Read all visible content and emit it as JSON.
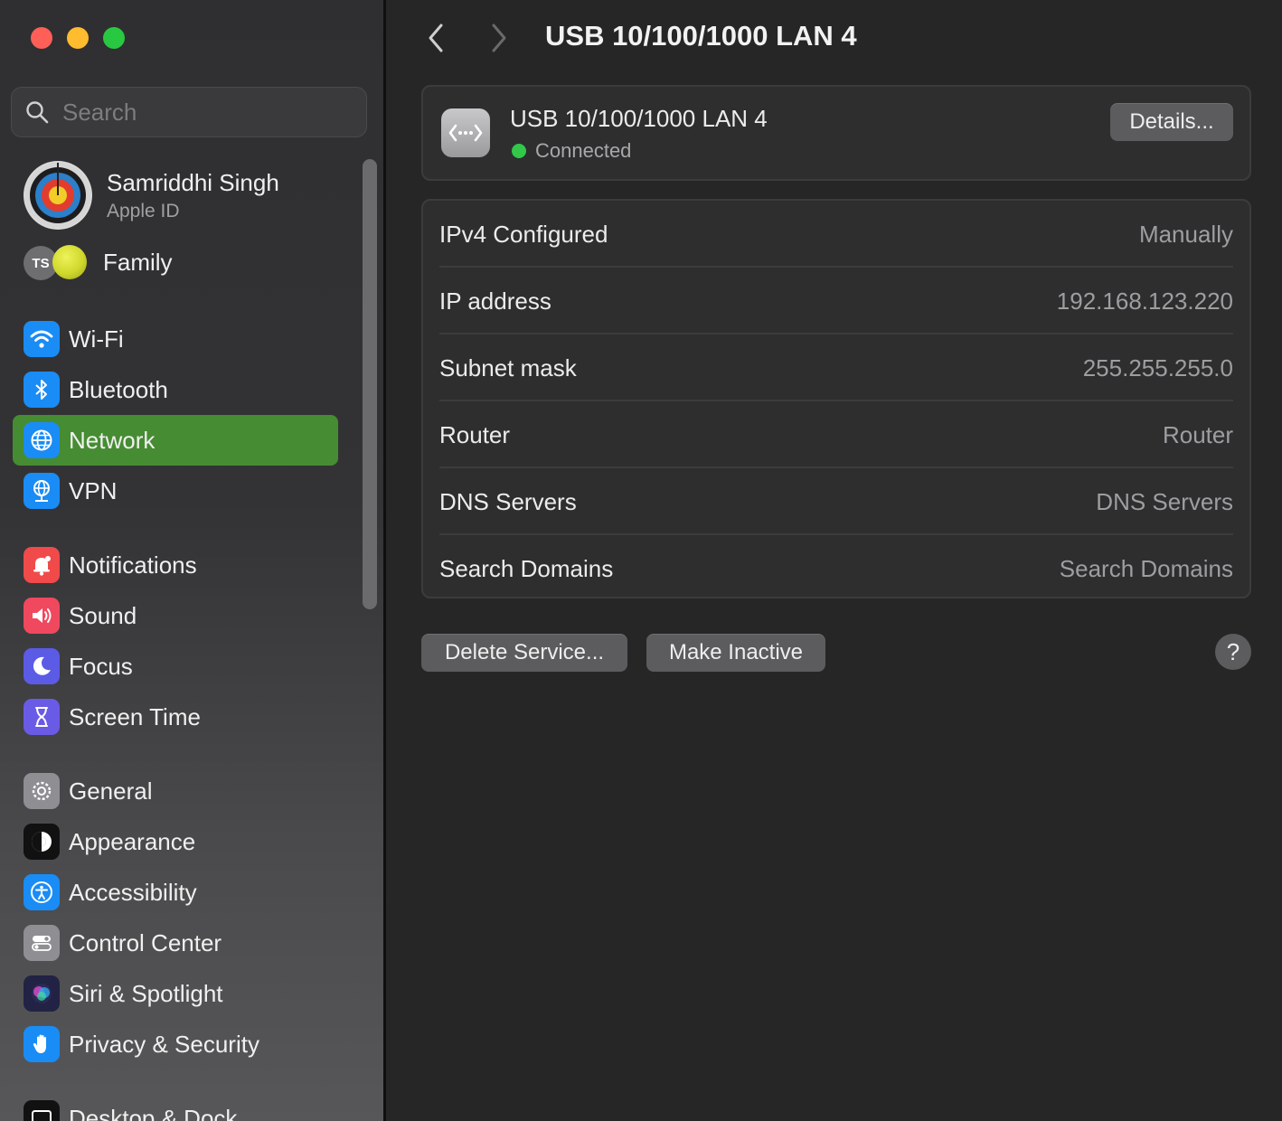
{
  "window": {
    "title": "USB 10/100/1000 LAN 4"
  },
  "sidebar": {
    "search": {
      "placeholder": "Search",
      "value": ""
    },
    "profile": {
      "name": "Samriddhi Singh",
      "subtitle": "Apple ID"
    },
    "family": {
      "label": "Family",
      "initials": "TS"
    },
    "items": [
      {
        "label": "Wi-Fi",
        "icon": "wifi-icon",
        "color": "#1a8cf5"
      },
      {
        "label": "Bluetooth",
        "icon": "bluetooth-icon",
        "color": "#1a8cf5"
      },
      {
        "label": "Network",
        "icon": "globe-icon",
        "color": "#1a8cf5",
        "selected": true
      },
      {
        "label": "VPN",
        "icon": "vpn-globe-icon",
        "color": "#1a8cf5"
      },
      {
        "label": "Notifications",
        "icon": "bell-icon",
        "color": "#f04a4a"
      },
      {
        "label": "Sound",
        "icon": "speaker-icon",
        "color": "#f0485e"
      },
      {
        "label": "Focus",
        "icon": "moon-icon",
        "color": "#5b5be6"
      },
      {
        "label": "Screen Time",
        "icon": "hourglass-icon",
        "color": "#6a5be6"
      },
      {
        "label": "General",
        "icon": "gear-icon",
        "color": "#8e8e93"
      },
      {
        "label": "Appearance",
        "icon": "appearance-icon",
        "color": "#111111"
      },
      {
        "label": "Accessibility",
        "icon": "accessibility-icon",
        "color": "#1a8cf5"
      },
      {
        "label": "Control Center",
        "icon": "toggles-icon",
        "color": "#8e8e93"
      },
      {
        "label": "Siri & Spotlight",
        "icon": "siri-icon",
        "color": "#222244"
      },
      {
        "label": "Privacy & Security",
        "icon": "hand-icon",
        "color": "#1a8cf5"
      },
      {
        "label": "Desktop & Dock",
        "icon": "dock-icon",
        "color": "#111111"
      }
    ],
    "accent": "#468c32"
  },
  "main": {
    "service": {
      "name": "USB 10/100/1000 LAN 4",
      "status": "Connected",
      "status_color": "#31c84a",
      "details_label": "Details..."
    },
    "rows": [
      {
        "key": "IPv4 Configured",
        "value": "Manually"
      },
      {
        "key": "IP address",
        "value": "192.168.123.220"
      },
      {
        "key": "Subnet mask",
        "value": "255.255.255.0"
      },
      {
        "key": "Router",
        "value": "Router"
      },
      {
        "key": "DNS Servers",
        "value": "DNS Servers"
      },
      {
        "key": "Search Domains",
        "value": "Search Domains"
      }
    ],
    "buttons": {
      "delete": "Delete Service...",
      "inactive": "Make Inactive",
      "help": "?"
    }
  }
}
